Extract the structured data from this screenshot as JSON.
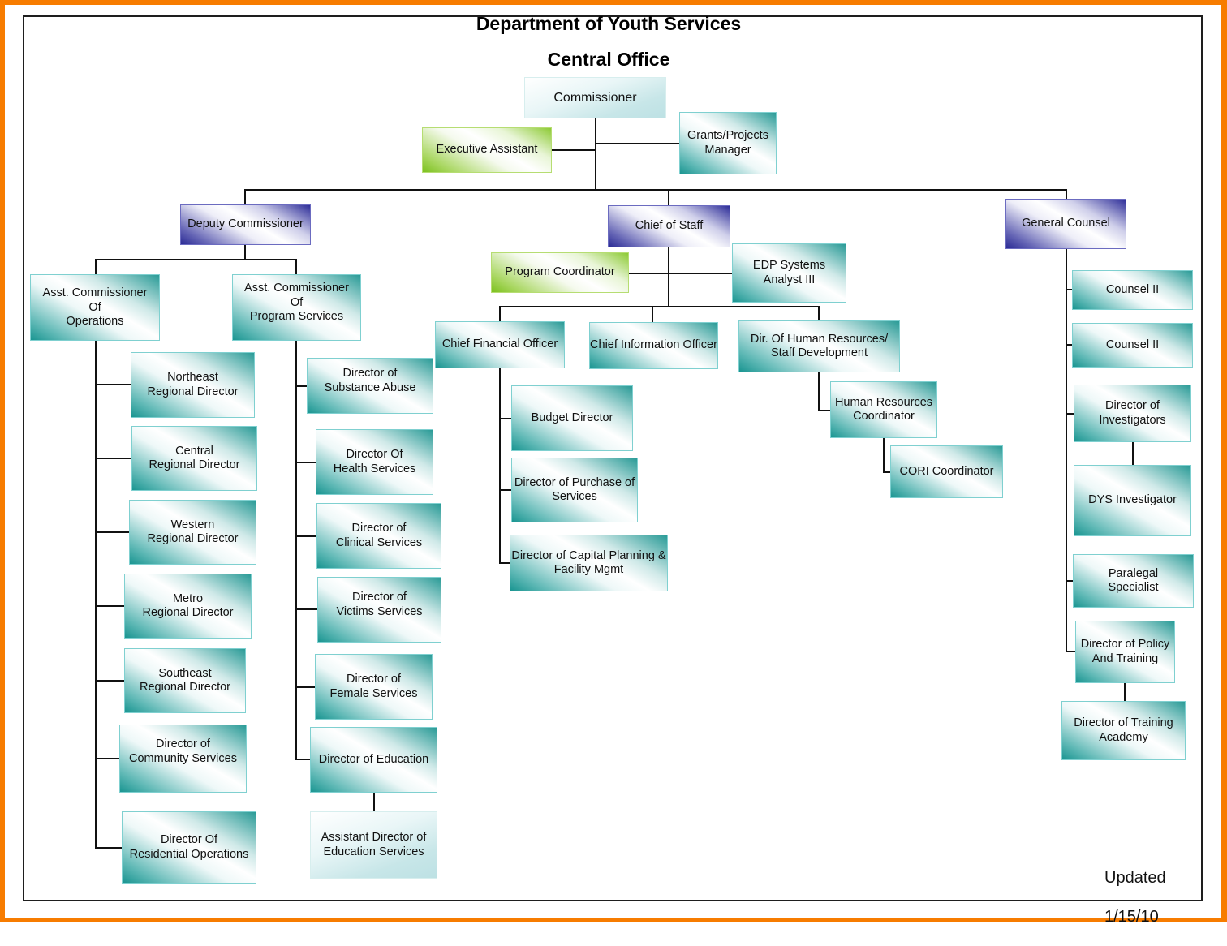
{
  "title": "Department of Youth Services",
  "subtitle": "Central Office",
  "updated": {
    "label": "Updated",
    "date": "1/15/10"
  },
  "colors": {
    "border_frame": "#f77c00",
    "teal": "#1a9591",
    "purple": "#2b2b95",
    "green": "#7cc11f",
    "pale": "#bde1e4"
  },
  "nodes": {
    "commissioner": "Commissioner",
    "executive_assistant": "Executive Assistant",
    "grants_manager": "Grants/Projects\nManager",
    "deputy_commissioner": "Deputy Commissioner",
    "chief_of_staff": "Chief of Staff",
    "general_counsel": "General Counsel",
    "asst_comm_operations": "Asst. Commissioner\nOf\nOperations",
    "asst_comm_program": "Asst.  Commissioner\nOf\nProgram Services",
    "northeast": "Northeast\nRegional Director",
    "central": "Central\nRegional Director",
    "western": "Western\nRegional Director",
    "metro": "Metro\nRegional Director",
    "southeast": "Southeast\nRegional Director",
    "community": "Director of\nCommunity Services",
    "residential": "Director Of\nResidential Operations",
    "substance": "Director of\nSubstance Abuse",
    "health": "Director Of\nHealth Services",
    "clinical": "Director of\nClinical Services",
    "victims": "Director of\nVictims Services",
    "female": "Director of\nFemale Services",
    "education": "Director of Education",
    "asst_education": "Assistant Director of\nEducation Services",
    "program_coordinator": "Program Coordinator",
    "edp_analyst": "EDP Systems\nAnalyst III",
    "cfo": "Chief Financial Officer",
    "cio": "Chief Information Officer",
    "hr_director": "Dir. Of Human Resources/\nStaff Development",
    "budget": "Budget Director",
    "purchase": "Director of Purchase of\nServices",
    "capital": "Director of Capital Planning &\nFacility Mgmt",
    "hr_coordinator": "Human Resources\nCoordinator",
    "cori": "CORI Coordinator",
    "counsel_1": "Counsel II",
    "counsel_2": "Counsel II",
    "investigators": "Director of\nInvestigators",
    "dys_investigator": "DYS Investigator",
    "paralegal": "Paralegal\nSpecialist",
    "policy_training": "Director of Policy\nAnd Training",
    "training_academy": "Director of Training\nAcademy"
  }
}
